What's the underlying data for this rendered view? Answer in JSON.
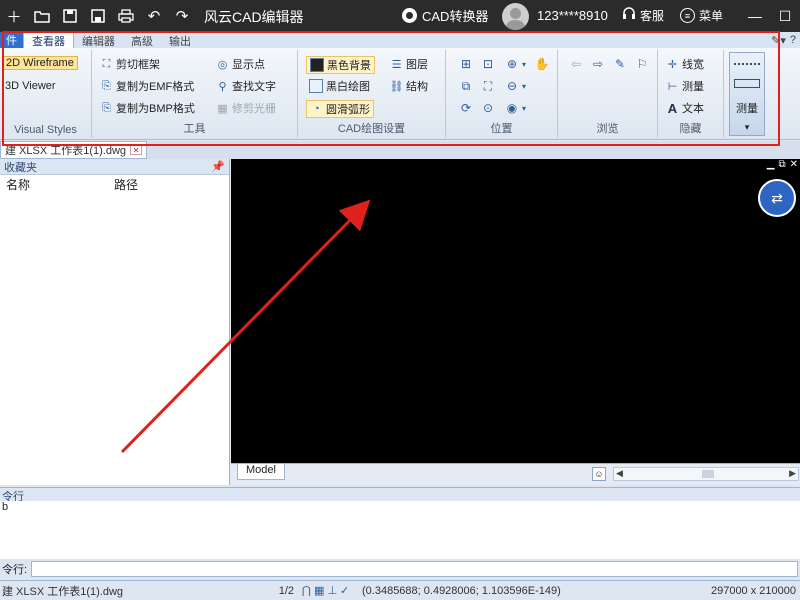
{
  "titlebar": {
    "app_title": "风云CAD编辑器",
    "converter_label": "CAD转换器",
    "user": "123****8910",
    "service_label": "客服",
    "menu_label": "菜单"
  },
  "tabs": [
    "查看器",
    "编辑器",
    "高级",
    "输出"
  ],
  "file_tab": "件",
  "ribbon": {
    "visual_styles": {
      "wireframe": "2D Wireframe",
      "viewer3d": "3D Viewer",
      "label": "Visual Styles"
    },
    "tools": {
      "clip_frame": "剪切框架",
      "copy_emf": "复制为EMF格式",
      "copy_bmp": "复制为BMP格式",
      "show_points": "显示点",
      "find_text": "查找文字",
      "trim_raster": "修剪光栅",
      "label": "工具"
    },
    "cad_settings": {
      "black_bg": "黑色背景",
      "bw_draw": "黑白绘图",
      "smooth_arc": "圆滑弧形",
      "layers": "图层",
      "structure": "结构",
      "label": "CAD绘图设置"
    },
    "position": {
      "label": "位置"
    },
    "browse": {
      "label": "浏览"
    },
    "hide": {
      "linewidth": "线宽",
      "measure": "测量",
      "text": "文本",
      "label": "隐藏"
    },
    "measure_big": "测量"
  },
  "doc_tab": "建 XLSX 工作表1(1).dwg",
  "left_panel": {
    "title": "收藏夹",
    "col_name": "名称",
    "col_path": "路径"
  },
  "canvas": {
    "model_tab": "Model"
  },
  "command": {
    "header": "令行",
    "body_text": "b",
    "input_label": "令行:"
  },
  "status": {
    "file": "建 XLSX 工作表1(1).dwg",
    "page": "1/2",
    "coords": "(0.3485688; 0.4928006; 1.103596E-149)",
    "size": "297000 x 210000"
  },
  "colors": {
    "annotation": "#e0211b",
    "titlebar": "#2b2b2b",
    "canvas": "#000000",
    "accent": "#2d66c2"
  }
}
